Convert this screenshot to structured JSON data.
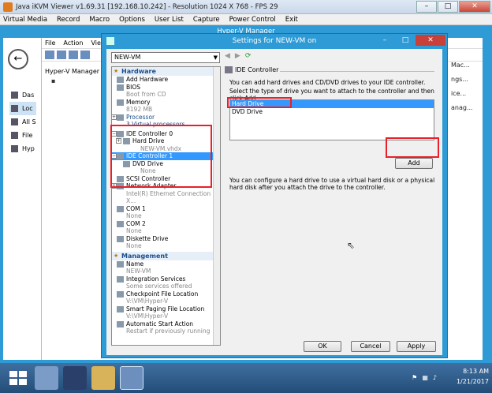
{
  "kvm": {
    "title": "Java iKVM Viewer v1.69.31 [192.168.10.242]  - Resolution 1024 X 768 - FPS 29",
    "menu": [
      "Virtual Media",
      "Record",
      "Macro",
      "Options",
      "User List",
      "Capture",
      "Power Control",
      "Exit"
    ]
  },
  "hyperv": {
    "title": "Hyper-V Manager",
    "nav": [
      "Das",
      "Loc",
      "All S",
      "File",
      "Hyp"
    ],
    "menu": [
      "File",
      "Action",
      "View"
    ],
    "tree_root": "Hyper-V Manager",
    "right_col": [
      "Mac...",
      "ngs...",
      "ice...",
      "anag..."
    ]
  },
  "dialog": {
    "title": "Settings for NEW-VM on",
    "vm_select": "NEW-VM",
    "tree": {
      "hardware_label": "Hardware",
      "items": [
        {
          "label": "Add Hardware",
          "sub": ""
        },
        {
          "label": "BIOS",
          "sub": "Boot from CD"
        },
        {
          "label": "Memory",
          "sub": "8192 MB"
        },
        {
          "label": "Processor",
          "sub": "3 Virtual processors"
        },
        {
          "label": "IDE Controller 0",
          "sub": ""
        },
        {
          "label": "Hard Drive",
          "sub": "NEW-VM.vhdx"
        },
        {
          "label": "IDE Controller 1",
          "sub": ""
        },
        {
          "label": "DVD Drive",
          "sub": "None"
        },
        {
          "label": "SCSI Controller",
          "sub": ""
        },
        {
          "label": "Network Adapter",
          "sub": "Intel(R) Ethernet Connection X..."
        },
        {
          "label": "COM 1",
          "sub": "None"
        },
        {
          "label": "COM 2",
          "sub": "None"
        },
        {
          "label": "Diskette Drive",
          "sub": "None"
        }
      ],
      "management_label": "Management",
      "mgmt_items": [
        {
          "label": "Name",
          "sub": "NEW-VM"
        },
        {
          "label": "Integration Services",
          "sub": "Some services offered"
        },
        {
          "label": "Checkpoint File Location",
          "sub": "V:\\VM\\Hyper-V"
        },
        {
          "label": "Smart Paging File Location",
          "sub": "V:\\VM\\Hyper-V"
        },
        {
          "label": "Automatic Start Action",
          "sub": "Restart if previously running"
        }
      ]
    },
    "panel": {
      "header": "IDE Controller",
      "desc1": "You can add hard drives and CD/DVD drives to your IDE controller.",
      "desc2": "Select the type of drive you want to attach to the controller and then click Add.",
      "options": [
        "Hard Drive",
        "DVD Drive"
      ],
      "add_label": "Add",
      "desc3": "You can configure a hard drive to use a virtual hard disk or a physical hard disk after you attach the drive to the controller."
    },
    "buttons": {
      "ok": "OK",
      "cancel": "Cancel",
      "apply": "Apply"
    }
  },
  "taskbar": {
    "time": "8:13 AM",
    "date": "1/21/2017"
  },
  "colors": {
    "accent": "#2e9bd6",
    "highlight": "#e8202a",
    "selection": "#3399ff"
  }
}
